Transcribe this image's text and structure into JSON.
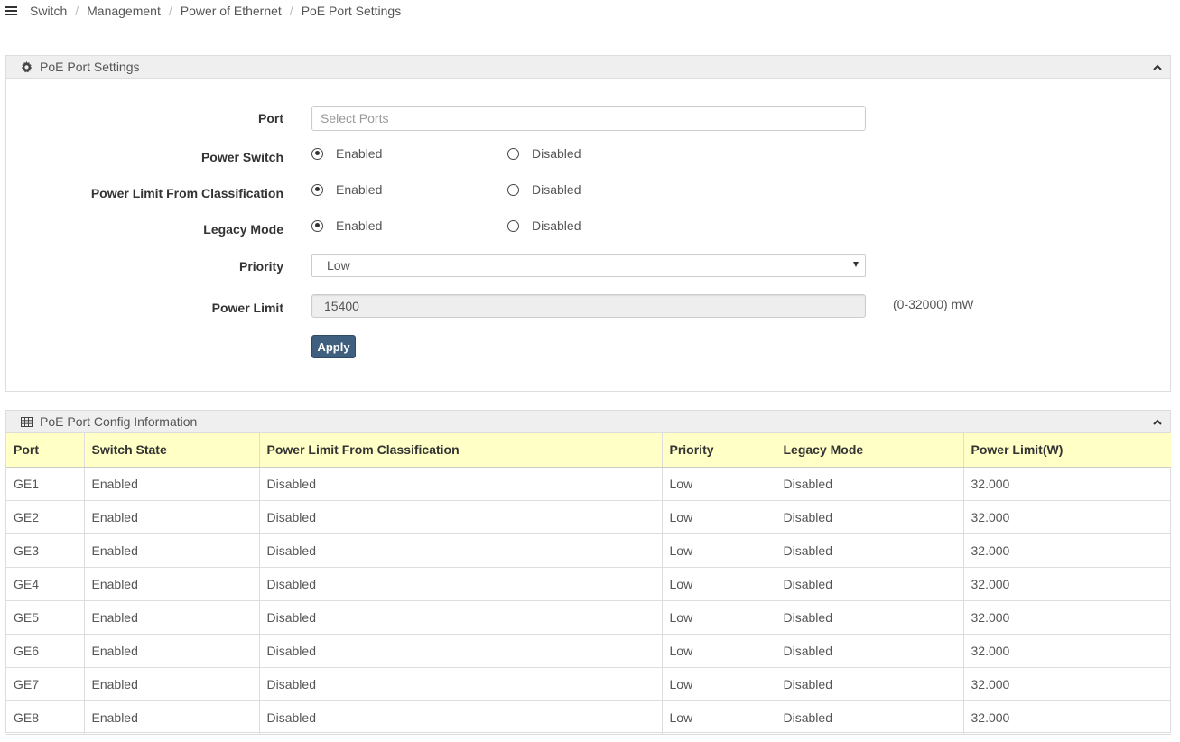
{
  "breadcrumb": {
    "items": [
      "Switch",
      "Management",
      "Power of Ethernet"
    ],
    "current": "PoE Port Settings"
  },
  "settings_panel": {
    "title": "PoE Port Settings",
    "icon": "gear-icon",
    "port": {
      "label": "Port",
      "placeholder": "Select Ports",
      "value": ""
    },
    "power_switch": {
      "label": "Power Switch",
      "options": [
        "Enabled",
        "Disabled"
      ],
      "selected": "Enabled"
    },
    "power_limit_class": {
      "label": "Power Limit From Classification",
      "options": [
        "Enabled",
        "Disabled"
      ],
      "selected": "Enabled"
    },
    "legacy_mode": {
      "label": "Legacy Mode",
      "options": [
        "Enabled",
        "Disabled"
      ],
      "selected": "Enabled"
    },
    "priority": {
      "label": "Priority",
      "value": "Low"
    },
    "power_limit": {
      "label": "Power Limit",
      "value": "15400",
      "unit": "(0-32000) mW"
    },
    "apply_label": "Apply"
  },
  "info_panel": {
    "title": "PoE Port Config Information",
    "icon": "table-icon",
    "columns": [
      "Port",
      "Switch State",
      "Power Limit From Classification",
      "Priority",
      "Legacy Mode",
      "Power Limit(W)"
    ],
    "rows": [
      [
        "GE1",
        "Enabled",
        "Disabled",
        "Low",
        "Disabled",
        "32.000"
      ],
      [
        "GE2",
        "Enabled",
        "Disabled",
        "Low",
        "Disabled",
        "32.000"
      ],
      [
        "GE3",
        "Enabled",
        "Disabled",
        "Low",
        "Disabled",
        "32.000"
      ],
      [
        "GE4",
        "Enabled",
        "Disabled",
        "Low",
        "Disabled",
        "32.000"
      ],
      [
        "GE5",
        "Enabled",
        "Disabled",
        "Low",
        "Disabled",
        "32.000"
      ],
      [
        "GE6",
        "Enabled",
        "Disabled",
        "Low",
        "Disabled",
        "32.000"
      ],
      [
        "GE7",
        "Enabled",
        "Disabled",
        "Low",
        "Disabled",
        "32.000"
      ],
      [
        "GE8",
        "Enabled",
        "Disabled",
        "Low",
        "Disabled",
        "32.000"
      ]
    ]
  },
  "colors": {
    "header_bg": "#efefef",
    "table_header_bg": "#ffffc6",
    "button_bg": "#3f5f7f"
  }
}
